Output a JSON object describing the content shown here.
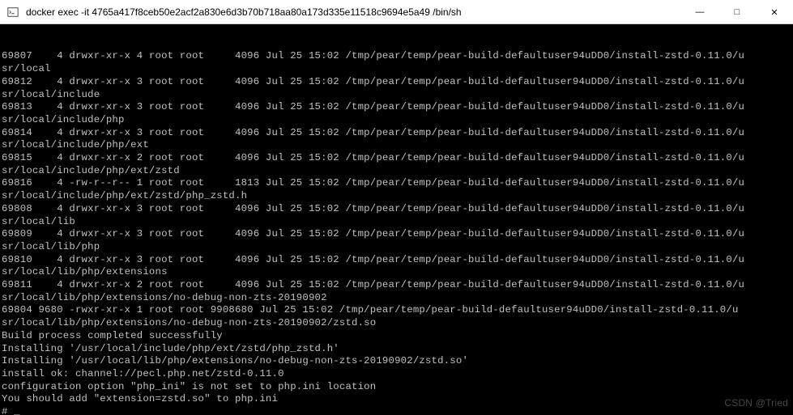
{
  "titlebar": {
    "icon": "terminal-icon",
    "title": "docker  exec  -it 4765a417f8ceb50e2acf2a830e6d3b70b718aa80a173d335e11518c9694e5a49 /bin/sh"
  },
  "winControls": {
    "minimize": "—",
    "maximize": "□",
    "close": "✕"
  },
  "terminal": {
    "lines": [
      "69807    4 drwxr-xr-x 4 root root     4096 Jul 25 15:02 /tmp/pear/temp/pear-build-defaultuser94uDD0/install-zstd-0.11.0/u",
      "sr/local",
      "69812    4 drwxr-xr-x 3 root root     4096 Jul 25 15:02 /tmp/pear/temp/pear-build-defaultuser94uDD0/install-zstd-0.11.0/u",
      "sr/local/include",
      "69813    4 drwxr-xr-x 3 root root     4096 Jul 25 15:02 /tmp/pear/temp/pear-build-defaultuser94uDD0/install-zstd-0.11.0/u",
      "sr/local/include/php",
      "69814    4 drwxr-xr-x 3 root root     4096 Jul 25 15:02 /tmp/pear/temp/pear-build-defaultuser94uDD0/install-zstd-0.11.0/u",
      "sr/local/include/php/ext",
      "69815    4 drwxr-xr-x 2 root root     4096 Jul 25 15:02 /tmp/pear/temp/pear-build-defaultuser94uDD0/install-zstd-0.11.0/u",
      "sr/local/include/php/ext/zstd",
      "69816    4 -rw-r--r-- 1 root root     1813 Jul 25 15:02 /tmp/pear/temp/pear-build-defaultuser94uDD0/install-zstd-0.11.0/u",
      "sr/local/include/php/ext/zstd/php_zstd.h",
      "69808    4 drwxr-xr-x 3 root root     4096 Jul 25 15:02 /tmp/pear/temp/pear-build-defaultuser94uDD0/install-zstd-0.11.0/u",
      "sr/local/lib",
      "69809    4 drwxr-xr-x 3 root root     4096 Jul 25 15:02 /tmp/pear/temp/pear-build-defaultuser94uDD0/install-zstd-0.11.0/u",
      "sr/local/lib/php",
      "69810    4 drwxr-xr-x 3 root root     4096 Jul 25 15:02 /tmp/pear/temp/pear-build-defaultuser94uDD0/install-zstd-0.11.0/u",
      "sr/local/lib/php/extensions",
      "69811    4 drwxr-xr-x 2 root root     4096 Jul 25 15:02 /tmp/pear/temp/pear-build-defaultuser94uDD0/install-zstd-0.11.0/u",
      "sr/local/lib/php/extensions/no-debug-non-zts-20190902",
      "69804 9680 -rwxr-xr-x 1 root root 9908680 Jul 25 15:02 /tmp/pear/temp/pear-build-defaultuser94uDD0/install-zstd-0.11.0/u",
      "sr/local/lib/php/extensions/no-debug-non-zts-20190902/zstd.so",
      "",
      "Build process completed successfully",
      "Installing '/usr/local/include/php/ext/zstd/php_zstd.h'",
      "Installing '/usr/local/lib/php/extensions/no-debug-non-zts-20190902/zstd.so'",
      "install ok: channel://pecl.php.net/zstd-0.11.0",
      "configuration option \"php_ini\" is not set to php.ini location",
      "You should add \"extension=zstd.so\" to php.ini",
      "# _"
    ]
  },
  "watermark": "CSDN @Tried"
}
